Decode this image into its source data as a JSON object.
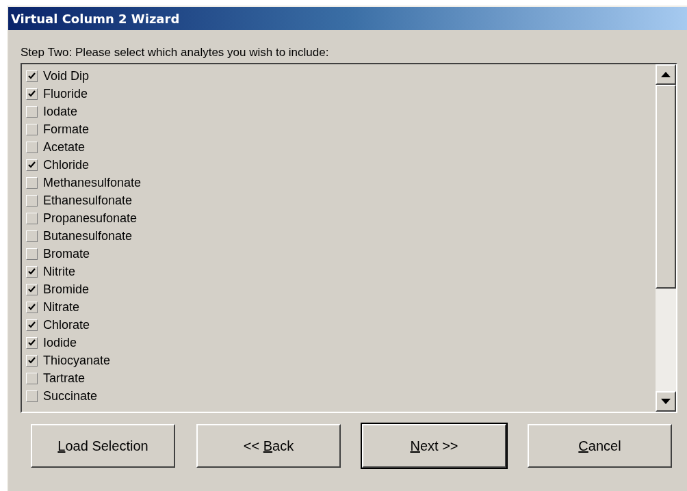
{
  "window": {
    "title": "Virtual Column 2 Wizard"
  },
  "prompt": "Step Two: Please select which analytes you wish to include:",
  "analytes": [
    {
      "label": "Void Dip",
      "checked": true
    },
    {
      "label": "Fluoride",
      "checked": true
    },
    {
      "label": "Iodate",
      "checked": false
    },
    {
      "label": "Formate",
      "checked": false
    },
    {
      "label": "Acetate",
      "checked": false
    },
    {
      "label": "Chloride",
      "checked": true
    },
    {
      "label": "Methanesulfonate",
      "checked": false
    },
    {
      "label": "Ethanesulfonate",
      "checked": false
    },
    {
      "label": "Propanesufonate",
      "checked": false
    },
    {
      "label": "Butanesulfonate",
      "checked": false
    },
    {
      "label": "Bromate",
      "checked": false
    },
    {
      "label": "Nitrite",
      "checked": true
    },
    {
      "label": "Bromide",
      "checked": true
    },
    {
      "label": "Nitrate",
      "checked": true
    },
    {
      "label": "Chlorate",
      "checked": true
    },
    {
      "label": "Iodide",
      "checked": true
    },
    {
      "label": "Thiocyanate",
      "checked": true
    },
    {
      "label": "Tartrate",
      "checked": false
    },
    {
      "label": "Succinate",
      "checked": false
    }
  ],
  "buttons": [
    {
      "key": "L",
      "after": "oad Selection",
      "default": false
    },
    {
      "before": "<< ",
      "key": "B",
      "after": "ack",
      "default": false
    },
    {
      "key": "N",
      "after": "ext >>",
      "default": true
    },
    {
      "key": "C",
      "after": "ancel",
      "default": false
    }
  ]
}
